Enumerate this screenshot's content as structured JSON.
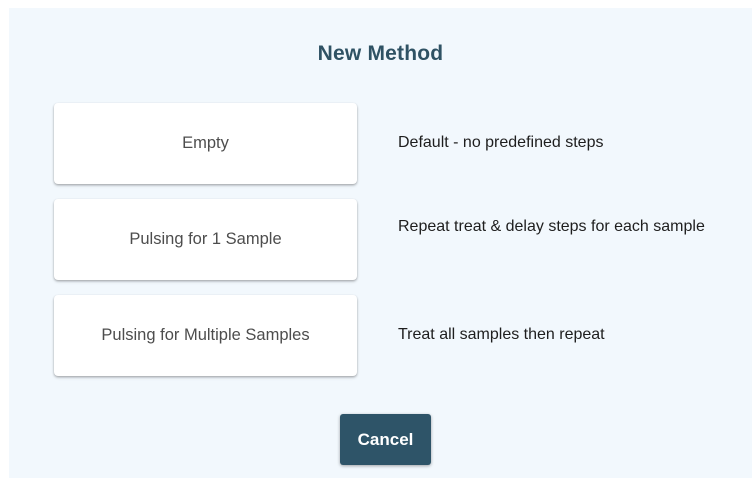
{
  "dialog": {
    "title": "New Method",
    "options": [
      {
        "label": "Empty",
        "description": "Default - no predefined steps"
      },
      {
        "label": "Pulsing for 1 Sample",
        "description": "Repeat treat & delay steps for each sample"
      },
      {
        "label": "Pulsing for Multiple Samples",
        "description": "Treat all samples then repeat"
      }
    ],
    "cancel_label": "Cancel"
  },
  "colors": {
    "dialog_background": "#f2f8fd",
    "title_text": "#2f5264",
    "card_background": "#ffffff",
    "cancel_button": "#2e5468"
  }
}
